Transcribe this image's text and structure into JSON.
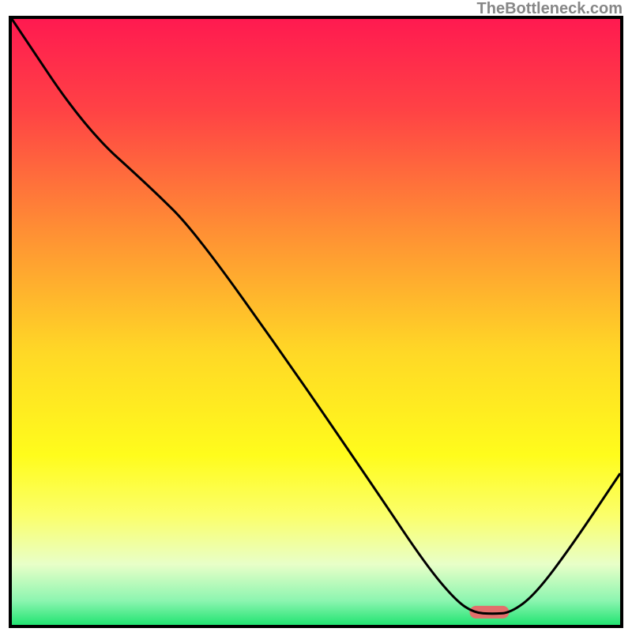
{
  "watermark": "TheBottleneck.com",
  "chart_data": {
    "type": "line",
    "title": "",
    "xlabel": "",
    "ylabel": "",
    "xlim": [
      0,
      100
    ],
    "ylim": [
      0,
      100
    ],
    "background_gradient": {
      "stops": [
        {
          "offset": 0.0,
          "color": "#ff1a50"
        },
        {
          "offset": 0.15,
          "color": "#ff4245"
        },
        {
          "offset": 0.35,
          "color": "#ff8f34"
        },
        {
          "offset": 0.55,
          "color": "#ffd826"
        },
        {
          "offset": 0.72,
          "color": "#fffc1c"
        },
        {
          "offset": 0.82,
          "color": "#fbff6b"
        },
        {
          "offset": 0.9,
          "color": "#e8ffc8"
        },
        {
          "offset": 0.96,
          "color": "#8cf5b0"
        },
        {
          "offset": 1.0,
          "color": "#22e472"
        }
      ]
    },
    "series": [
      {
        "name": "curve",
        "stroke": "#000000",
        "stroke_width": 3,
        "points": [
          {
            "x": 0.0,
            "y": 100.0
          },
          {
            "x": 12.0,
            "y": 82.0
          },
          {
            "x": 23.0,
            "y": 72.0
          },
          {
            "x": 30.0,
            "y": 65.0
          },
          {
            "x": 45.0,
            "y": 44.0
          },
          {
            "x": 60.0,
            "y": 22.0
          },
          {
            "x": 68.0,
            "y": 10.0
          },
          {
            "x": 73.0,
            "y": 4.0
          },
          {
            "x": 76.0,
            "y": 2.0
          },
          {
            "x": 79.0,
            "y": 1.8
          },
          {
            "x": 82.0,
            "y": 2.0
          },
          {
            "x": 86.0,
            "y": 5.0
          },
          {
            "x": 92.0,
            "y": 13.0
          },
          {
            "x": 100.0,
            "y": 25.0
          }
        ]
      }
    ],
    "marker": {
      "name": "optimal-marker",
      "color": "#e26f6b",
      "x_center": 78.5,
      "width": 6.5,
      "y": 2.1,
      "rx": 1.5
    }
  }
}
